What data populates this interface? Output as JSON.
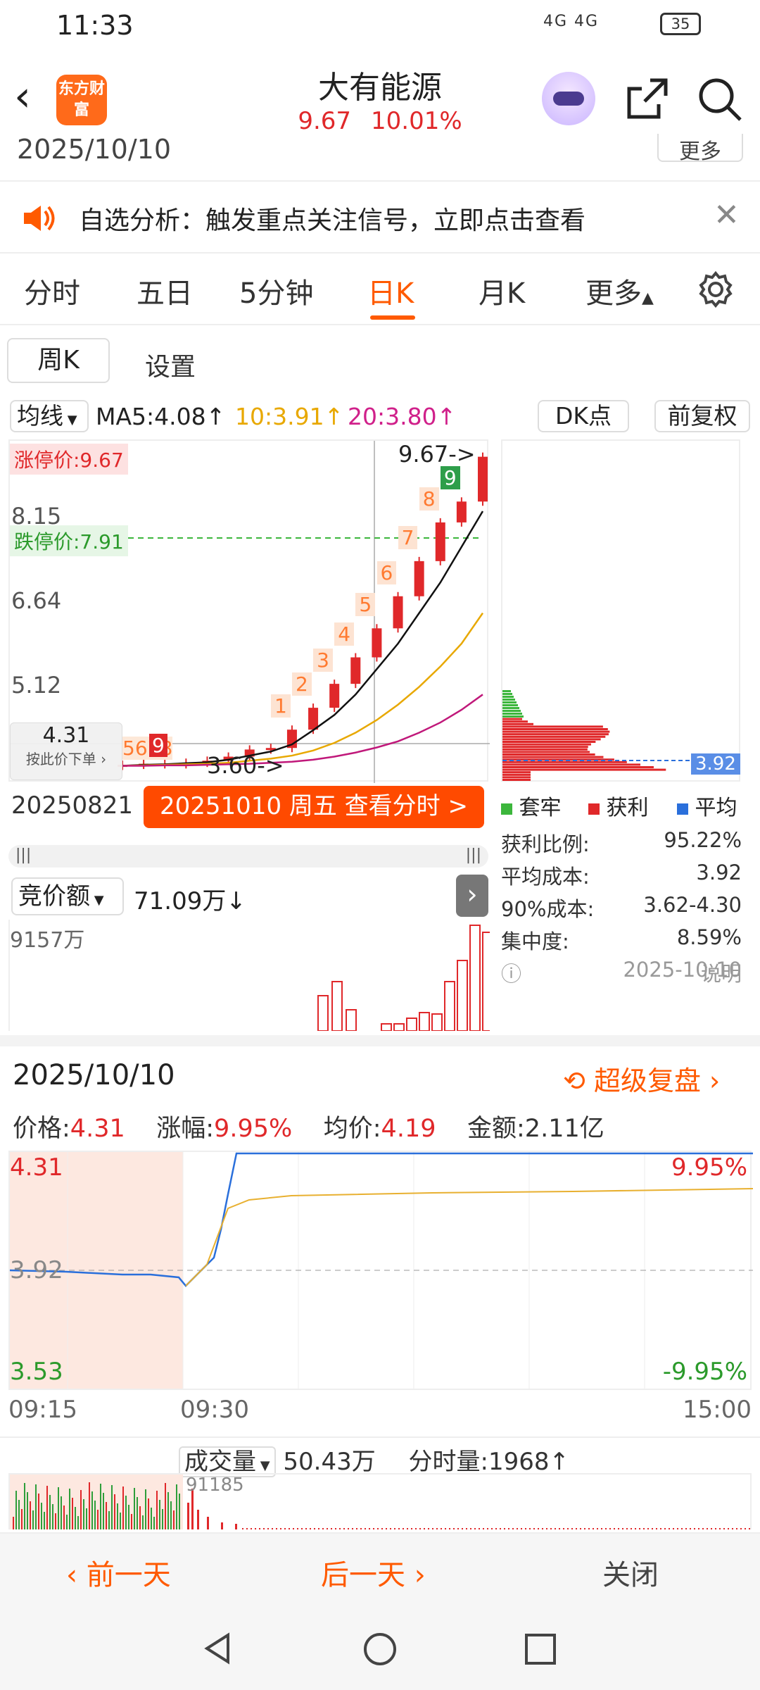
{
  "status": {
    "time": "11:33",
    "network": "4G 4G",
    "battery": "35"
  },
  "header": {
    "logo": "东方财富",
    "title": "大有能源",
    "price": "9.67",
    "change_pct": "10.01%"
  },
  "top_date": "2025/10/10",
  "top_more": "更多",
  "notice": {
    "text": "自选分析：触发重点关注信号，立即点击查看"
  },
  "tabs": [
    "分时",
    "五日",
    "5分钟",
    "日K",
    "月K",
    "更多"
  ],
  "subtabs": {
    "week": "周K",
    "settings": "设置"
  },
  "ma": {
    "label": "均线",
    "ma5": "MA5:4.08↑",
    "ma10": "10:3.91↑",
    "ma20": "20:3.80↑",
    "dk": "DK点",
    "adjust": "前复权"
  },
  "kline": {
    "limit_up": "涨停价:9.67",
    "limit_down": "跌停价:7.91",
    "y_labels": [
      "8.15",
      "6.64",
      "5.12"
    ],
    "high_marker": "9.67->",
    "low_marker": "3.60->",
    "price_tag": "4.31",
    "price_tag_sub": "按此价下单",
    "seq_left": "5678",
    "seq_9": "9",
    "seq_nums": [
      "1",
      "2",
      "3",
      "4",
      "5",
      "6",
      "7",
      "8",
      "9"
    ],
    "closes": [
      3.62,
      3.64,
      3.63,
      3.66,
      3.7,
      3.78,
      3.92,
      3.95,
      4.31,
      4.74,
      5.21,
      5.73,
      6.3,
      6.93,
      7.62,
      8.38,
      8.79,
      9.67
    ],
    "ma5": [
      3.6,
      3.62,
      3.63,
      3.65,
      3.67,
      3.72,
      3.8,
      3.88,
      4.02,
      4.3,
      4.6,
      5.0,
      5.5,
      6.0,
      6.6,
      7.2,
      7.9,
      8.6
    ],
    "ma10": [
      3.6,
      3.61,
      3.62,
      3.63,
      3.64,
      3.66,
      3.7,
      3.74,
      3.8,
      3.9,
      4.05,
      4.25,
      4.5,
      4.8,
      5.15,
      5.55,
      6.0,
      6.6
    ],
    "ma20": [
      3.6,
      3.6,
      3.61,
      3.61,
      3.62,
      3.63,
      3.64,
      3.66,
      3.68,
      3.72,
      3.78,
      3.86,
      3.96,
      4.08,
      4.25,
      4.45,
      4.7,
      5.0
    ]
  },
  "chips": {
    "date": "20250821",
    "cta": "20251010 周五 查看分时 >",
    "avg_tag": "3.92"
  },
  "auction": {
    "label": "竞价额",
    "value": "71.09万↓",
    "max": "9157万"
  },
  "cost": {
    "legend": [
      "套牢",
      "获利",
      "平均"
    ],
    "rows": [
      [
        "获利比例:",
        "95.22%"
      ],
      [
        "平均成本:",
        "3.92"
      ],
      [
        "90%成本:",
        "3.62-4.30"
      ],
      [
        "集中度:",
        "8.59%"
      ]
    ],
    "note": "说明",
    "date": "2025-10-10",
    "colors": {
      "trapped": "#3cb63c",
      "profit": "#e0282a",
      "avg": "#2a6fdb"
    }
  },
  "intraday": {
    "date": "2025/10/10",
    "replay": "超级复盘",
    "price_label": "价格:",
    "price": "4.31",
    "chg_label": "涨幅:",
    "chg": "9.95%",
    "avg_label": "均价:",
    "avg": "4.19",
    "amt_label": "金额:",
    "amt": "2.11亿",
    "high": "4.31",
    "mid": "3.92",
    "low": "3.53",
    "high_pct": "9.95%",
    "low_pct": "-9.95%",
    "times": [
      "09:15",
      "09:30",
      "15:00"
    ],
    "vol_label": "成交量",
    "vol": "50.43万",
    "tick_label": "分时量:",
    "tick": "1968↑",
    "vol_max": "91185"
  },
  "bottom": {
    "prev": "前一天",
    "next": "后一天",
    "close": "关闭"
  }
}
